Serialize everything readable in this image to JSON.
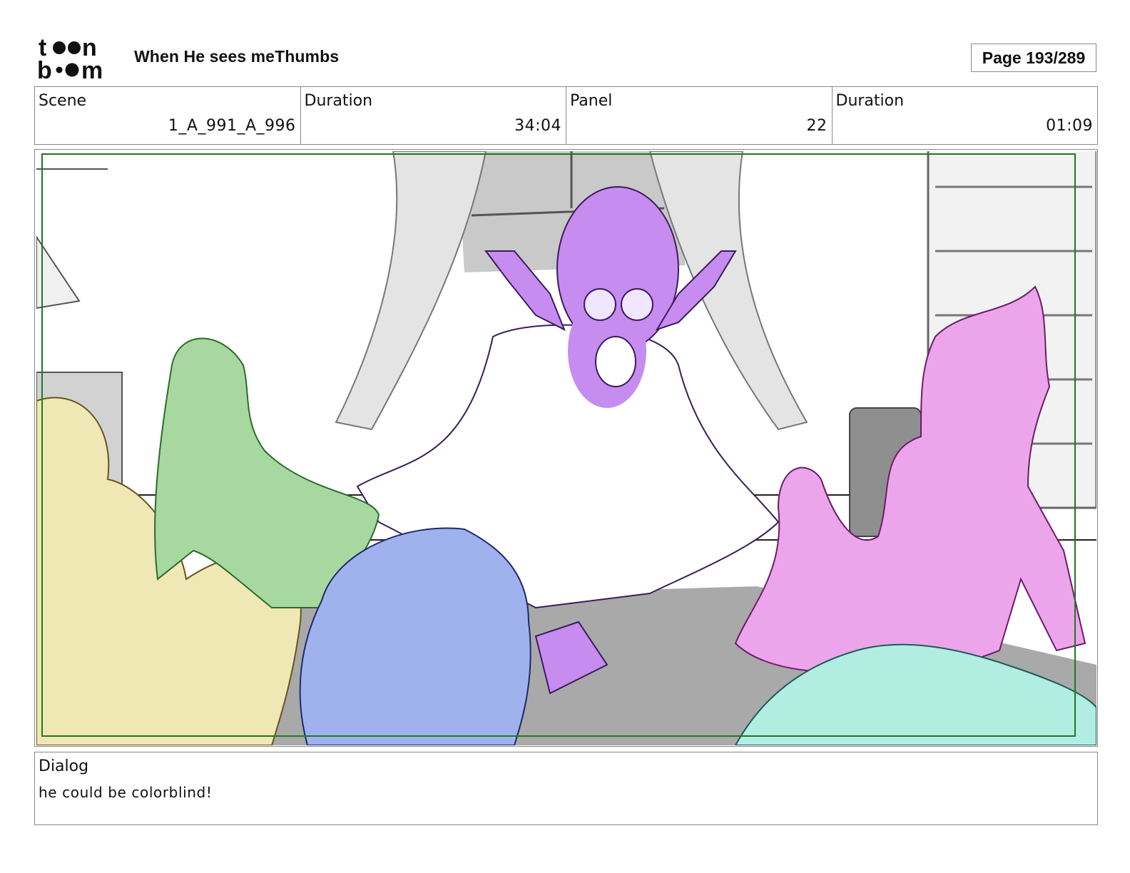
{
  "header": {
    "logo_text": "toon boom",
    "project_title": "When He sees meThumbs",
    "page_label": "Page 193/289"
  },
  "info": {
    "scene_label": "Scene",
    "scene_value": "1_A_991_A_996",
    "scene_duration_label": "Duration",
    "scene_duration_value": "34:04",
    "panel_label": "Panel",
    "panel_value": "22",
    "panel_duration_label": "Duration",
    "panel_duration_value": "01:09"
  },
  "panel_image": {
    "subject": "storyboard-sketch",
    "colors": {
      "yellow": "#efe8b4",
      "green": "#a7d8a0",
      "blue": "#a0b2ee",
      "purple": "#c68cf0",
      "pink": "#eca5ea",
      "teal": "#b2ede2",
      "floor": "#a9a9a9",
      "frame": "#1d7a1d"
    }
  },
  "dialog": {
    "label": "Dialog",
    "text": "he could be colorblind!"
  }
}
